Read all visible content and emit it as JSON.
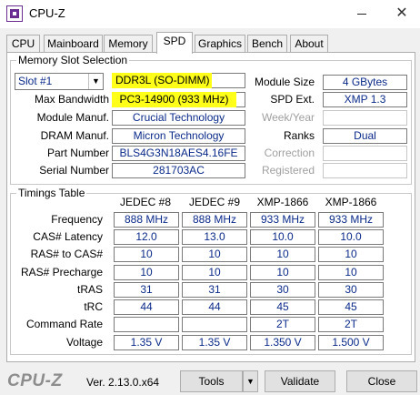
{
  "window": {
    "title": "CPU-Z",
    "minimize": "—",
    "close": "✕",
    "icon": "cpu-z-app-icon"
  },
  "tabs": [
    "CPU",
    "Mainboard",
    "Memory",
    "SPD",
    "Graphics",
    "Bench",
    "About"
  ],
  "active_tab": "SPD",
  "slot_section": {
    "title": "Memory Slot Selection",
    "slot_selected": "Slot #1",
    "slot_arrow": "▼",
    "memory_type": "DDR3L (SO-DIMM)",
    "labels": {
      "max_bandwidth": "Max Bandwidth",
      "module_manuf": "Module Manuf.",
      "dram_manuf": "DRAM Manuf.",
      "part_number": "Part Number",
      "serial_number": "Serial Number",
      "module_size": "Module Size",
      "spd_ext": "SPD Ext.",
      "week_year": "Week/Year",
      "ranks": "Ranks",
      "correction": "Correction",
      "registered": "Registered"
    },
    "values": {
      "max_bandwidth": "PC3-14900 (933 MHz)",
      "module_manuf": "Crucial Technology",
      "dram_manuf": "Micron Technology",
      "part_number": "BLS4G3N18AES4.16FE",
      "serial_number": "281703AC",
      "module_size": "4 GBytes",
      "spd_ext": "XMP 1.3",
      "week_year": "",
      "ranks": "Dual",
      "correction": "",
      "registered": ""
    },
    "highlight_color": "#ffff1a"
  },
  "timings": {
    "title": "Timings Table",
    "columns": [
      "JEDEC #8",
      "JEDEC #9",
      "XMP-1866",
      "XMP-1866"
    ],
    "rows": [
      {
        "label": "Frequency",
        "values": [
          "888 MHz",
          "888 MHz",
          "933 MHz",
          "933 MHz"
        ]
      },
      {
        "label": "CAS# Latency",
        "values": [
          "12.0",
          "13.0",
          "10.0",
          "10.0"
        ]
      },
      {
        "label": "RAS# to CAS#",
        "values": [
          "10",
          "10",
          "10",
          "10"
        ]
      },
      {
        "label": "RAS# Precharge",
        "values": [
          "10",
          "10",
          "10",
          "10"
        ]
      },
      {
        "label": "tRAS",
        "values": [
          "31",
          "31",
          "30",
          "30"
        ]
      },
      {
        "label": "tRC",
        "values": [
          "44",
          "44",
          "45",
          "45"
        ]
      },
      {
        "label": "Command Rate",
        "values": [
          "",
          "",
          "2T",
          "2T"
        ]
      },
      {
        "label": "Voltage",
        "values": [
          "1.35 V",
          "1.35 V",
          "1.350 V",
          "1.500 V"
        ]
      }
    ]
  },
  "footer": {
    "logo": "CPU-Z",
    "version": "Ver. 2.13.0.x64",
    "tools": "Tools",
    "tools_arrow": "▼",
    "validate": "Validate",
    "close": "Close"
  }
}
